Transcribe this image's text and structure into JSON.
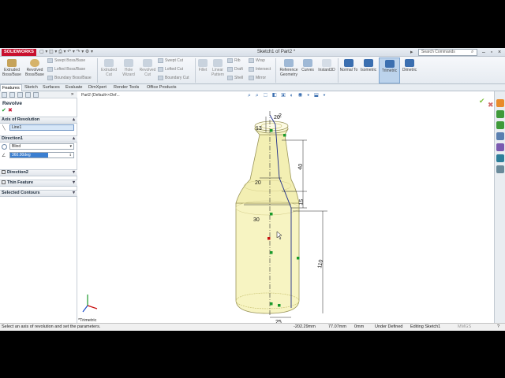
{
  "app": {
    "logo": "SOLIDWORKS",
    "doc_title": "Sketch1 of Part2 *",
    "search_placeholder": "Search Commands"
  },
  "ribbon": {
    "extruded_boss": "Extruded Boss/Base",
    "revolved_boss": "Revolved Boss/Base",
    "swept_boss": "Swept Boss/Base",
    "lofted_boss": "Lofted Boss/Base",
    "boundary_boss": "Boundary Boss/Base",
    "extruded_cut": "Extruded Cut",
    "hole_wizard": "Hole Wizard",
    "revolved_cut": "Revolved Cut",
    "swept_cut": "Swept Cut",
    "lofted_cut": "Lofted Cut",
    "boundary_cut": "Boundary Cut",
    "fillet": "Fillet",
    "linear_pattern": "Linear Pattern",
    "rib": "Rib",
    "draft": "Draft",
    "shell": "Shell",
    "wrap": "Wrap",
    "intersect": "Intersect",
    "mirror": "Mirror",
    "reference_geometry": "Reference Geometry",
    "curves": "Curves",
    "instant3d": "Instant3D",
    "normal_to": "Normal To",
    "isometric": "Isometric",
    "trimetric": "Trimetric",
    "dimetric": "Dimetric"
  },
  "tabs": [
    "Features",
    "Sketch",
    "Surfaces",
    "Evaluate",
    "DimXpert",
    "Render Tools",
    "Office Products"
  ],
  "panel": {
    "title": "Revolve",
    "axis_section": "Axis of Revolution",
    "axis_value": "Line1",
    "direction1": "Direction1",
    "type_value": "Blind",
    "angle_value": "360.00deg",
    "direction2": "Direction2",
    "thin_feature": "Thin Feature",
    "selected_contours": "Selected Contours"
  },
  "viewport": {
    "tree_item": "Part2  (Default<<Def...",
    "orientation": "*Trimetric",
    "dimensions": [
      "13",
      "20",
      "40",
      "15",
      "20",
      "30",
      "110",
      "25",
      "2"
    ]
  },
  "status": {
    "message": "Select an axis of revolution and set the parameters.",
    "x": "-202.29mm",
    "y": "77.07mm",
    "z": "0mm",
    "state": "Under Defined",
    "editing": "Editing Sketch1",
    "units": "MMGS"
  },
  "colors": {
    "brand": "#c8102e",
    "accent": "#3b7fd1",
    "model_fill": "#f7f4c2",
    "sketch_green": "#1a9a2a"
  }
}
